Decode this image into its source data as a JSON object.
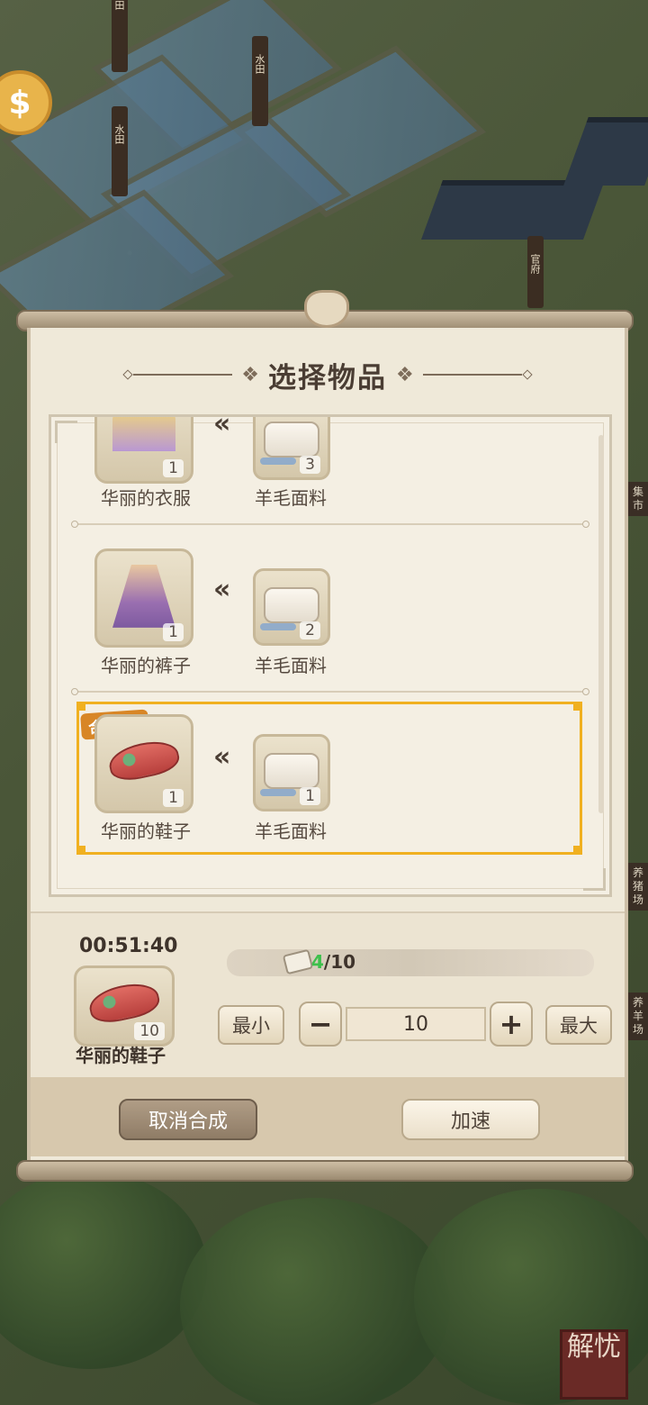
{
  "background": {
    "field_signs": [
      "田",
      "水田",
      "水田"
    ],
    "building_sign": "官府",
    "side_signs": [
      "集市",
      "养猪场",
      "养羊场"
    ],
    "stamp_text": "解忧"
  },
  "dialog": {
    "title": "选择物品",
    "recipes": [
      {
        "product": {
          "name": "华丽的衣服",
          "count": "1"
        },
        "material": {
          "name": "羊毛面料",
          "count": "3"
        }
      },
      {
        "product": {
          "name": "华丽的裤子",
          "count": "1"
        },
        "material": {
          "name": "羊毛面料",
          "count": "2"
        }
      },
      {
        "product": {
          "name": "华丽的鞋子",
          "count": "1"
        },
        "material": {
          "name": "羊毛面料",
          "count": "1"
        },
        "badge": "合成中!"
      }
    ],
    "crafting": {
      "timer": "00:51:40",
      "item_name": "华丽的鞋子",
      "item_count": "10",
      "material_have": "4",
      "material_total": "/10",
      "min_label": "最小",
      "max_label": "最大",
      "quantity": "10"
    },
    "buttons": {
      "cancel": "取消合成",
      "speed_up": "加速"
    }
  },
  "colors": {
    "highlight": "#f0b020",
    "progress_green": "#3ec04c",
    "badge": "#d88626"
  }
}
